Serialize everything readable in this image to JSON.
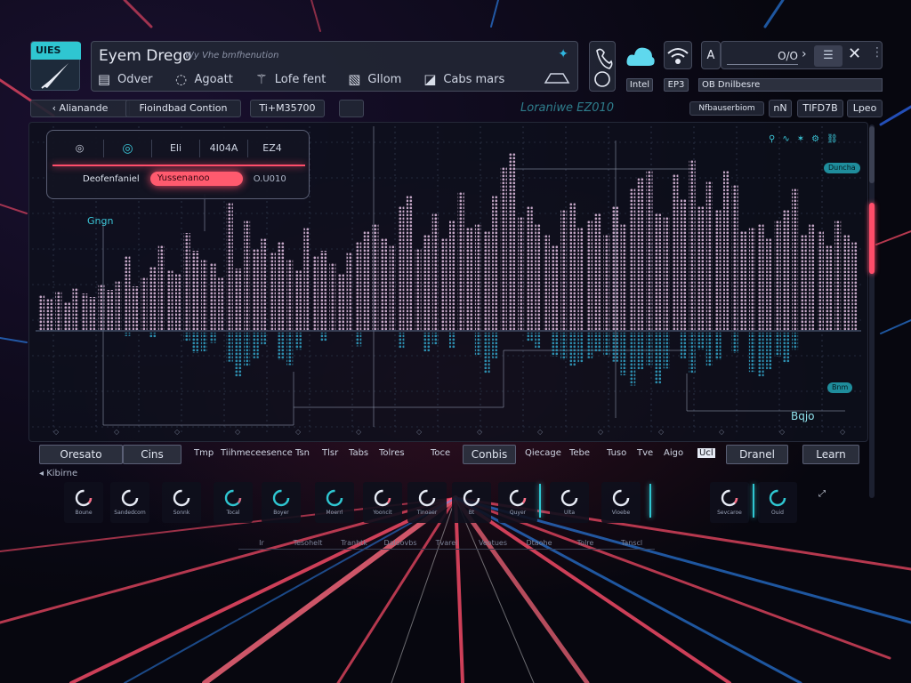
{
  "app": {
    "badge": "UIES",
    "title": "Eyem Drego",
    "subtitle": "Wy Vhe bmfhenution"
  },
  "nav": [
    {
      "label": "Odver",
      "icon": "grid-icon"
    },
    {
      "label": "Agoatt",
      "icon": "circle-icon"
    },
    {
      "label": "Lofe fent",
      "icon": "wand-icon"
    },
    {
      "label": "Gllom",
      "icon": "image-icon"
    },
    {
      "label": "Cabs mars",
      "icon": "chart-icon"
    }
  ],
  "tiles": {
    "tile1_label": "Intel",
    "tile2_label": "EP3",
    "tile3_label": "A"
  },
  "top_right": {
    "value": "O/O",
    "search": "OB Dnilbesre"
  },
  "toolbar2": {
    "back": "Alianande",
    "filter": "Fioindbad Contion",
    "value": "Ti+M35700",
    "center": "Loraniwe EZ010",
    "right1": "Nfbauserbiom",
    "right2": "nN",
    "right3": "TIFD7B",
    "right4": "Lpeo"
  },
  "card": {
    "icon1": "◎",
    "icon2": "◎",
    "icon3": "Eli",
    "icon4": "4I04A",
    "icon5": "EZ4",
    "row_label": "Deofenfaniel",
    "pill": "Yussenanoo",
    "value": "O.U010"
  },
  "chart_labels": {
    "legend": "Gngn",
    "tag_top": "Duncha",
    "tag_bottom": "Bnm",
    "corner": "Bqjo"
  },
  "chart_data": {
    "type": "bar",
    "bars_per_series": 96,
    "series": [
      {
        "values": [
          0.2,
          0.18,
          0.22,
          0.16,
          0.24,
          0.21,
          0.19,
          0.26,
          0.23,
          0.28,
          0.42,
          0.25,
          0.3,
          0.36,
          0.48,
          0.34,
          0.32,
          0.55,
          0.45,
          0.4,
          0.38,
          0.3,
          0.72,
          0.35,
          0.62,
          0.46,
          0.52,
          0.44,
          0.5,
          0.4,
          0.34,
          0.58,
          0.42,
          0.45,
          0.38,
          0.32,
          0.44,
          0.5,
          0.56,
          0.6,
          0.52,
          0.48,
          0.7,
          0.76,
          0.46,
          0.54,
          0.66,
          0.52,
          0.62,
          0.78,
          0.58,
          0.6,
          0.56,
          0.76,
          0.92,
          1.0,
          0.64,
          0.7,
          0.6,
          0.54,
          0.48,
          0.68,
          0.72,
          0.58,
          0.62,
          0.66,
          0.54,
          0.7,
          0.6,
          0.8,
          0.86,
          0.9,
          0.66,
          0.64,
          0.88,
          0.74,
          0.96,
          0.7,
          0.84,
          0.68,
          0.9,
          0.82,
          0.56,
          0.58,
          0.6,
          0.52,
          0.62,
          0.68,
          0.8,
          0.54,
          0.6,
          0.56,
          0.48,
          0.62,
          0.54,
          0.5
        ]
      },
      {
        "values": [
          0.0,
          0.0,
          0.0,
          0.0,
          0.0,
          0.0,
          0.0,
          0.0,
          0.0,
          0.0,
          0.04,
          0.0,
          0.0,
          0.06,
          0.0,
          0.0,
          0.0,
          0.1,
          0.24,
          0.22,
          0.12,
          0.0,
          0.34,
          0.52,
          0.4,
          0.3,
          0.14,
          0.0,
          0.32,
          0.38,
          0.2,
          0.0,
          0.0,
          0.1,
          0.0,
          0.0,
          0.0,
          0.16,
          0.0,
          0.0,
          0.0,
          0.0,
          0.18,
          0.0,
          0.0,
          0.22,
          0.14,
          0.0,
          0.18,
          0.0,
          0.0,
          0.26,
          0.48,
          0.3,
          0.0,
          0.0,
          0.0,
          0.1,
          0.18,
          0.0,
          0.28,
          0.32,
          0.4,
          0.36,
          0.3,
          0.22,
          0.26,
          0.34,
          0.5,
          0.62,
          0.44,
          0.38,
          0.6,
          0.42,
          0.0,
          0.3,
          0.48,
          0.2,
          0.4,
          0.32,
          0.0,
          0.24,
          0.0,
          0.46,
          0.52,
          0.44,
          0.28,
          0.36,
          0.2,
          0.0,
          0.0,
          0.0,
          0.0,
          0.0,
          0.0,
          0.0
        ]
      }
    ]
  },
  "bottom_toolbar": {
    "btn1": "Oresato",
    "btn2": "Cins",
    "words": [
      "Tmp",
      "Tiihmeceesence",
      "Tsn",
      "Tlsr",
      "Tabs",
      "Tolres",
      "Toce"
    ],
    "btn3": "Conbis",
    "words2": [
      "Qiecage",
      "Tebe",
      "Tuso",
      "Tve",
      "Aigo",
      "Ucl"
    ],
    "btn4": "Dranel",
    "btn5": "Learn"
  },
  "selection_label": "Kibirne",
  "dials": [
    {
      "label": "Boune"
    },
    {
      "label": "Sandedcom"
    },
    {
      "label": "Sonnk"
    },
    {
      "label": "Tocal"
    },
    {
      "label": "Boyer"
    },
    {
      "label": "Moerrl"
    },
    {
      "label": "Yooncit"
    },
    {
      "label": "Tinoaer"
    },
    {
      "label": "Bt"
    },
    {
      "label": "Quyer"
    },
    {
      "label": "Ulta"
    },
    {
      "label": "Vioebe"
    },
    {
      "label": "Sevcaroe"
    },
    {
      "label": "Ouid"
    }
  ],
  "footer_labels": [
    "Ir",
    "Tesohelt",
    "Tranhtk",
    "Daloovbs",
    "Tvarel",
    "Veotues",
    "Dtaohe",
    "Tolre",
    "Tanscl"
  ],
  "colors": {
    "accent_red": "#ff4d6a",
    "accent_teal": "#2fc6d1",
    "bar_top": "#c5a7c7",
    "bar_bottom": "#2d8fb0"
  }
}
